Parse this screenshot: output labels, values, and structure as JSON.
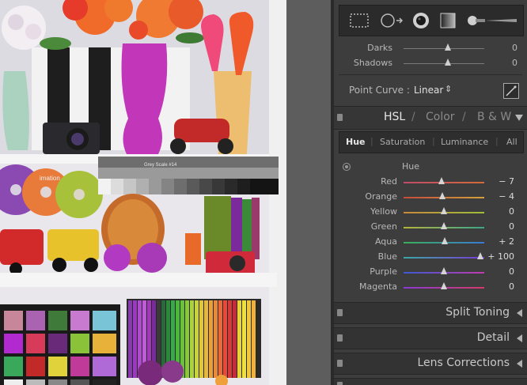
{
  "tone_sliders": [
    {
      "label": "Darks",
      "value": "0",
      "level": 0.55
    },
    {
      "label": "Shadows",
      "value": "0",
      "level": 0.55
    }
  ],
  "point_curve": {
    "label": "Point Curve :",
    "value": "Linear",
    "arrows": "⇕"
  },
  "hsl_header": {
    "hsl": "HSL",
    "sep1": "/",
    "color": "Color",
    "sep2": "/",
    "bw": "B & W"
  },
  "hsl_tabs": [
    {
      "label": "Hue",
      "active": true
    },
    {
      "label": "Saturation",
      "active": false
    },
    {
      "label": "Luminance",
      "active": false
    },
    {
      "label": "All",
      "active": false
    }
  ],
  "hsl_section_label": "Hue",
  "hue_sliders": [
    {
      "label": "Red",
      "value": "− 7",
      "level": 0.47,
      "gradient": [
        "#c14b6a",
        "#d46a3a"
      ]
    },
    {
      "label": "Orange",
      "value": "− 4",
      "level": 0.48,
      "gradient": [
        "#c84a3a",
        "#d4a23a"
      ]
    },
    {
      "label": "Yellow",
      "value": "0",
      "level": 0.5,
      "gradient": [
        "#c98a3a",
        "#9dbf3a"
      ]
    },
    {
      "label": "Green",
      "value": "0",
      "level": 0.5,
      "gradient": [
        "#b7b43a",
        "#3aa88a"
      ]
    },
    {
      "label": "Aqua",
      "value": "+ 2",
      "level": 0.51,
      "gradient": [
        "#3ab05a",
        "#3a7ad4"
      ]
    },
    {
      "label": "Blue",
      "value": "+ 100",
      "level": 0.95,
      "gradient": [
        "#3aa8a8",
        "#7a3ad4"
      ]
    },
    {
      "label": "Purple",
      "value": "0",
      "level": 0.5,
      "gradient": [
        "#3a5ad4",
        "#c43ab0"
      ]
    },
    {
      "label": "Magenta",
      "value": "0",
      "level": 0.5,
      "gradient": [
        "#8a3ad4",
        "#d43a6a"
      ]
    }
  ],
  "sections": [
    {
      "title": "Split Toning"
    },
    {
      "title": "Detail"
    },
    {
      "title": "Lens Corrections"
    }
  ],
  "photo": {
    "grey_scale_label": "Grey Scale #14",
    "cd_brand": "imation"
  }
}
